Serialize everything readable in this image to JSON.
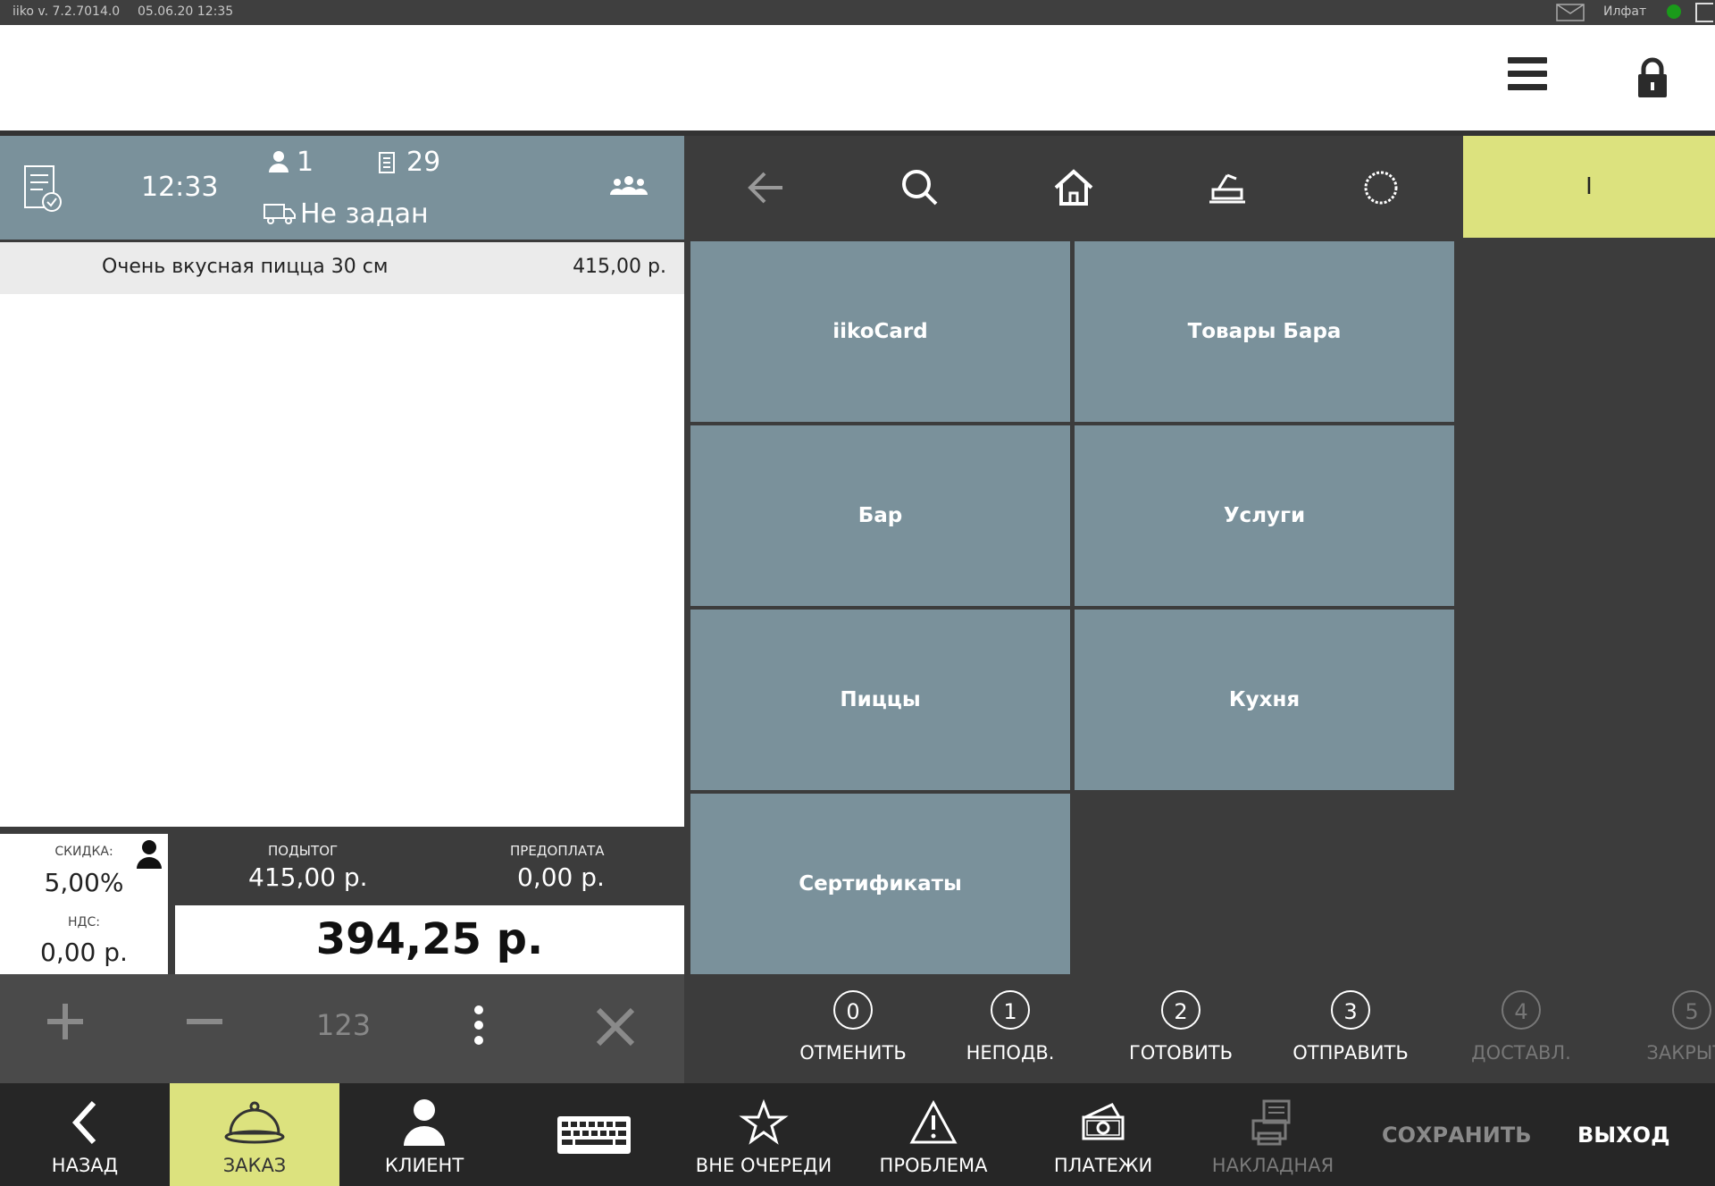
{
  "status_bar": {
    "app_version": "iiko  v. 7.2.7014.0",
    "datetime": "05.06.20   12:35",
    "user": "Илфат"
  },
  "order_header": {
    "time": "12:33",
    "guests": "1",
    "order_number": "29",
    "delivery": "Не задан"
  },
  "order_items": [
    {
      "name": "Очень вкусная пицца 30 см",
      "price": "415,00 р."
    }
  ],
  "totals": {
    "discount_label": "СКИДКА:",
    "discount_value": "5,00%",
    "vat_label": "НДС:",
    "vat_value": "0,00 р.",
    "subtotal_label": "ПОДЫТОГ",
    "subtotal_value": "415,00 р.",
    "prepay_label": "ПРЕДОПЛАТА",
    "prepay_value": "0,00 р.",
    "total_value": "394,25 р."
  },
  "category_mode": "I",
  "categories": [
    "iikoCard",
    "Товары Бара",
    "Бар",
    "Услуги",
    "Пиццы",
    "Кухня",
    "Сертификаты"
  ],
  "qty_bar": {
    "numpad": "123"
  },
  "statuses": [
    {
      "num": "0",
      "label": "ОТМЕНИТЬ"
    },
    {
      "num": "1",
      "label": "НЕПОДВ."
    },
    {
      "num": "2",
      "label": "ГОТОВИТЬ"
    },
    {
      "num": "3",
      "label": "ОТПРАВИТЬ"
    },
    {
      "num": "4",
      "label": "ДОСТАВЛ."
    },
    {
      "num": "5",
      "label": "ЗАКРЫТЬ"
    }
  ],
  "bottom_bar": {
    "back": "НАЗАД",
    "order": "ЗАКАЗ",
    "client": "КЛИЕНТ",
    "priority": "ВНЕ ОЧЕРЕДИ",
    "problem": "ПРОБЛЕМА",
    "payments": "ПЛАТЕЖИ",
    "invoice": "НАКЛАДНАЯ",
    "save": "СОХРАНИТЬ",
    "exit": "ВЫХОД"
  },
  "colors": {
    "accent": "#dce27e",
    "tile": "#7a919b",
    "panel": "#3c3c3c",
    "bottom": "#262626"
  }
}
